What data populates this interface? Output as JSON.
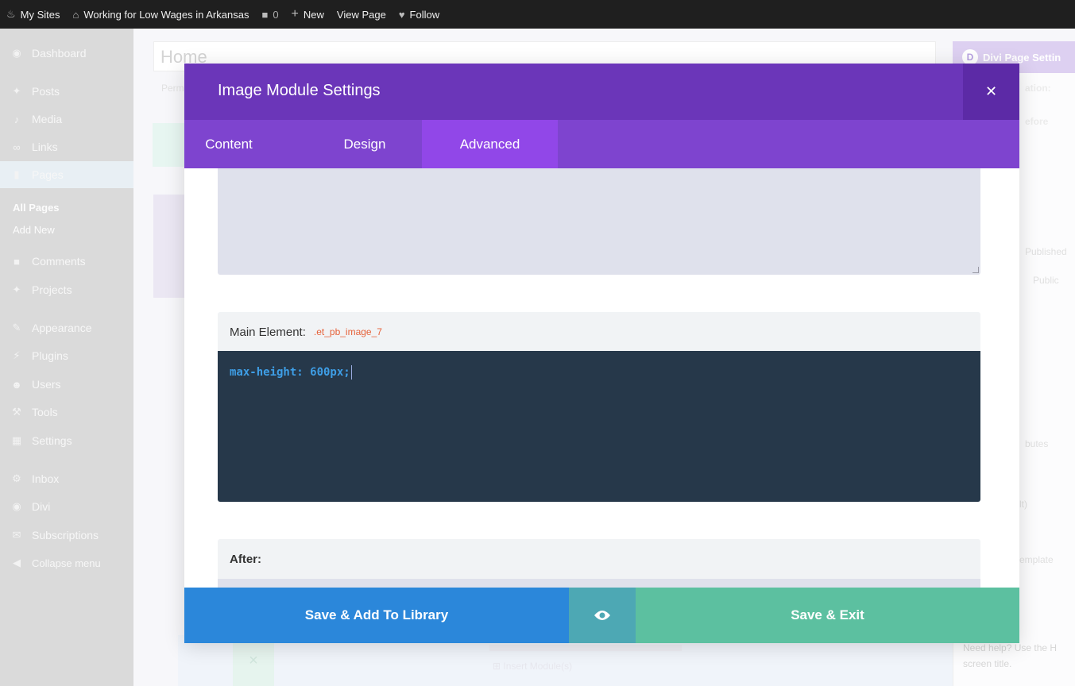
{
  "adminbar": {
    "my_sites": "My Sites",
    "site_name": "Working for Low Wages in Arkansas",
    "comments_count": "0",
    "new": "New",
    "view_page": "View Page",
    "follow": "Follow"
  },
  "sidebar": {
    "items": [
      {
        "label": "Dashboard",
        "icon": "dashboard-icon"
      },
      {
        "label": "Posts",
        "icon": "pin-icon"
      },
      {
        "label": "Media",
        "icon": "media-icon"
      },
      {
        "label": "Links",
        "icon": "link-icon"
      },
      {
        "label": "Pages",
        "icon": "pages-icon"
      },
      {
        "label": "Comments",
        "icon": "comment-icon"
      },
      {
        "label": "Projects",
        "icon": "pin-icon"
      },
      {
        "label": "Appearance",
        "icon": "brush-icon"
      },
      {
        "label": "Plugins",
        "icon": "plug-icon"
      },
      {
        "label": "Users",
        "icon": "user-icon"
      },
      {
        "label": "Tools",
        "icon": "wrench-icon"
      },
      {
        "label": "Settings",
        "icon": "settings-icon"
      },
      {
        "label": "Inbox",
        "icon": "gear-icon"
      },
      {
        "label": "Divi",
        "icon": "divi-icon"
      },
      {
        "label": "Subscriptions",
        "icon": "mail-icon"
      },
      {
        "label": "Collapse menu",
        "icon": "collapse-icon"
      }
    ],
    "sub_all_pages": "All Pages",
    "sub_add_new": "Add New"
  },
  "background": {
    "page_title": "Home",
    "permalink": "Perm",
    "insert_module": "Insert Module(s)"
  },
  "right_panel": {
    "title": "Divi Page Settin",
    "location": "ation:",
    "before": "efore",
    "published": "Published",
    "public": "Public",
    "attributes": "butes",
    "default": "lt)",
    "template": "emplate",
    "help": "Need help? Use the H screen title."
  },
  "modal": {
    "title": "Image Module Settings",
    "tabs": [
      "Content",
      "Design",
      "Advanced"
    ],
    "active_tab": "Advanced",
    "main_element_label": "Main Element:",
    "main_element_selector": ".et_pb_image_7",
    "css_code": "max-height: 600px;",
    "after_label": "After:",
    "footer": {
      "save_library": "Save & Add To Library",
      "save_exit": "Save & Exit"
    }
  },
  "colors": {
    "header": "#6b36b9",
    "tabs": "#7e44cf",
    "active_tab": "#9147e8",
    "code_bg": "#26384a",
    "save_library": "#2b87da",
    "preview": "#4da8b4",
    "save_exit": "#5cc0a0"
  }
}
